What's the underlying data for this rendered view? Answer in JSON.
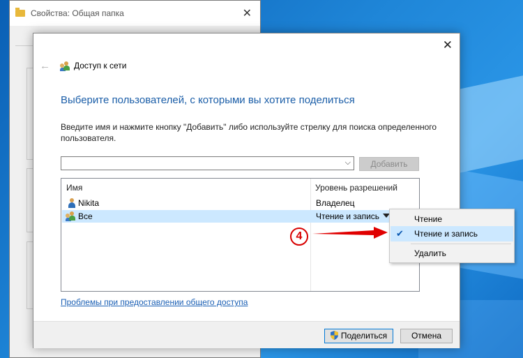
{
  "back_window": {
    "title": "Свойства: Общая папка"
  },
  "dialog": {
    "title": "Доступ к сети",
    "heading": "Выберите пользователей, с которыми вы хотите поделиться",
    "description": "Введите имя и нажмите кнопку \"Добавить\" либо используйте стрелку для поиска определенного пользователя.",
    "input": {
      "value": "",
      "placeholder": ""
    },
    "add_button": "Добавить",
    "columns": {
      "name": "Имя",
      "permission": "Уровень разрешений"
    },
    "rows": [
      {
        "name": "Nikita",
        "permission": "Владелец",
        "icon": "user-icon"
      },
      {
        "name": "Все",
        "permission": "Чтение и запись",
        "icon": "users-group-icon",
        "selected": true
      }
    ],
    "help_link": "Проблемы при предоставлении общего доступа",
    "share_button": "Поделиться",
    "cancel_button": "Отмена"
  },
  "permission_menu": {
    "items": [
      {
        "label": "Чтение",
        "checked": false
      },
      {
        "label": "Чтение и запись",
        "checked": true
      },
      {
        "label": "Удалить",
        "checked": false
      }
    ]
  },
  "annotation": {
    "number": "4",
    "color": "#d80000"
  },
  "colors": {
    "heading": "#1b5ea8",
    "selection": "#cce8ff",
    "link": "#1a5fb4"
  }
}
